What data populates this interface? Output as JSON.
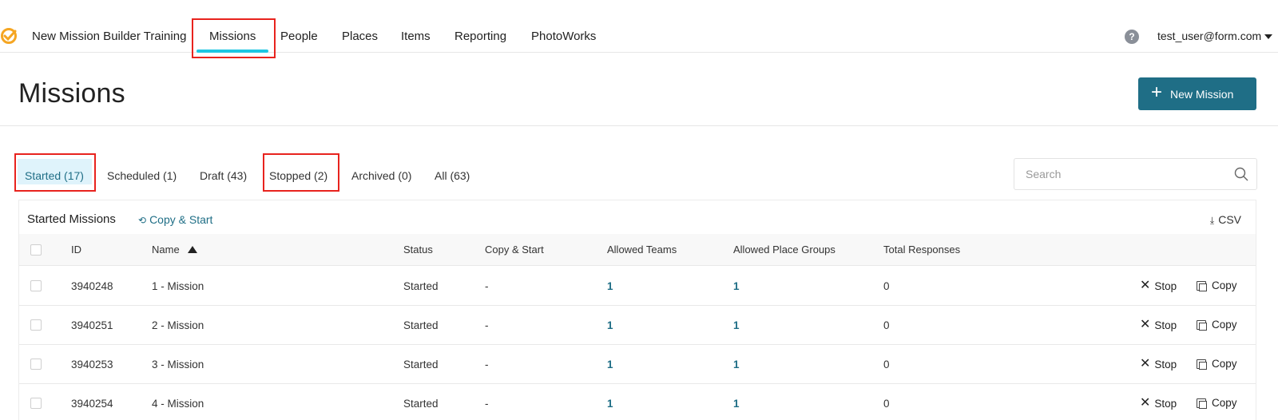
{
  "nav": {
    "app_title": "New Mission Builder Training",
    "items": [
      "Missions",
      "People",
      "Places",
      "Items",
      "Reporting",
      "PhotoWorks"
    ],
    "help": "?",
    "user": "test_user@form.com"
  },
  "header": {
    "title": "Missions",
    "new_button": "New Mission"
  },
  "tabs": [
    "Started (17)",
    "Scheduled (1)",
    "Draft (43)",
    "Stopped (2)",
    "Archived (0)",
    "All (63)"
  ],
  "search": {
    "placeholder": "Search"
  },
  "card": {
    "title": "Started Missions",
    "copy_start": "Copy & Start",
    "csv": "CSV"
  },
  "table": {
    "columns": [
      "ID",
      "Name",
      "Status",
      "Copy & Start",
      "Allowed Teams",
      "Allowed Place Groups",
      "Total Responses"
    ],
    "rows": [
      {
        "id": "3940248",
        "name": "1 - Mission",
        "status": "Started",
        "copy_start": "-",
        "teams": "1",
        "place_groups": "1",
        "responses": "0"
      },
      {
        "id": "3940251",
        "name": "2 - Mission",
        "status": "Started",
        "copy_start": "-",
        "teams": "1",
        "place_groups": "1",
        "responses": "0"
      },
      {
        "id": "3940253",
        "name": "3 - Mission",
        "status": "Started",
        "copy_start": "-",
        "teams": "1",
        "place_groups": "1",
        "responses": "0"
      },
      {
        "id": "3940254",
        "name": "4 - Mission",
        "status": "Started",
        "copy_start": "-",
        "teams": "1",
        "place_groups": "1",
        "responses": "0"
      }
    ],
    "actions": {
      "stop": "Stop",
      "copy": "Copy"
    }
  },
  "colors": {
    "accent": "#1f6e86",
    "underline": "#1ec6e3",
    "highlight": "#e8231e",
    "logo": "#f5a623"
  }
}
